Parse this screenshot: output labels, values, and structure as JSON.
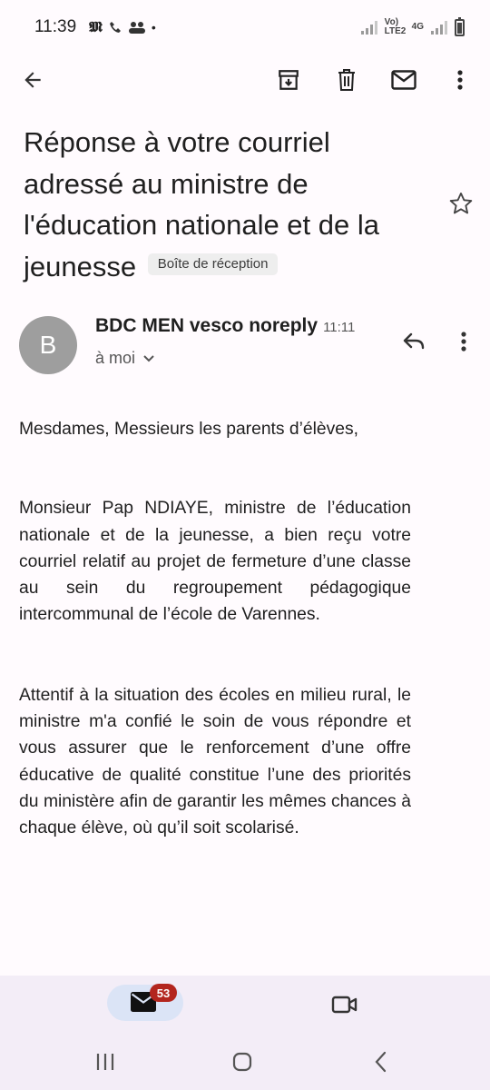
{
  "status_bar": {
    "time": "11:39",
    "notification_icons": [
      "m-app-icon",
      "phone-icon",
      "people-icon"
    ],
    "dot": "•",
    "network_sim1": "Vo) LTE2",
    "network_sim2": "4G"
  },
  "toolbar": {
    "back_icon": "back-arrow-icon",
    "archive_icon": "archive-icon",
    "delete_icon": "trash-icon",
    "mark_unread_icon": "mail-icon",
    "more_icon": "more-vert-icon"
  },
  "email": {
    "subject": "Réponse à votre courriel adressé au ministre de l'éducation nationale et de la jeunesse",
    "label": "Boîte de réception",
    "sender_initial": "B",
    "sender_name": "BDC MEN vesco noreply",
    "time": "11:11",
    "recipient": "à moi",
    "body": [
      "Mesdames, Messieurs les parents d’élèves,",
      "Monsieur Pap NDIAYE, ministre de l’éducation nationale et de la jeunesse, a bien reçu votre courriel relatif au projet de fermeture d’une classe au sein du regroupement pédagogique intercommunal de l’école de Varennes.",
      "Attentif à la situation des écoles en milieu rural, le ministre m'a confié le soin de vous répondre et vous assurer que le renforcement d’une offre éducative de qualité constitue l’une des priorités du ministère afin de garantir les mêmes chances à chaque élève, où qu’il soit scolarisé."
    ]
  },
  "bottom_nav": {
    "mail_badge": "53",
    "mail_icon": "mail-icon",
    "meet_icon": "video-icon"
  },
  "colors": {
    "background": "#fffbfe",
    "nav_background": "#f3edf7",
    "active_pill": "#dbe4f6",
    "badge": "#b3261e",
    "avatar": "#9e9e9e"
  }
}
